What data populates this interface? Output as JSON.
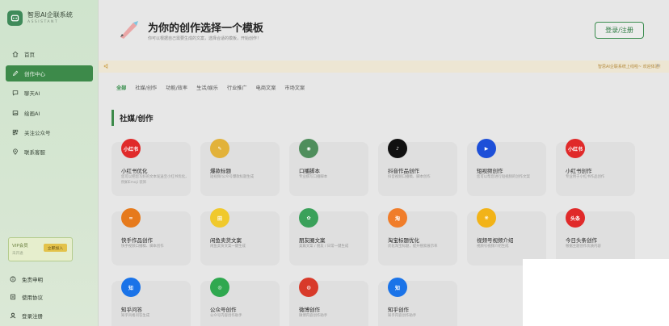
{
  "brand": {
    "title": "智思AI企联系统",
    "subtitle": "ASSISTANT"
  },
  "nav": [
    {
      "label": "首页",
      "icon": "home-icon"
    },
    {
      "label": "创作中心",
      "icon": "edit-icon",
      "active": true
    },
    {
      "label": "聊天AI",
      "icon": "chat-icon"
    },
    {
      "label": "绘画AI",
      "icon": "image-icon"
    },
    {
      "label": "关注公众号",
      "icon": "qrcode-icon"
    },
    {
      "label": "联系客服",
      "icon": "location-icon"
    }
  ],
  "vip": {
    "title": "VIP会员",
    "desc": "未开通",
    "button": "立即加入"
  },
  "bottom_nav": [
    {
      "label": "免责申明",
      "icon": "info-icon"
    },
    {
      "label": "使用协议",
      "icon": "doc-icon"
    },
    {
      "label": "登录注册",
      "icon": "user-icon"
    }
  ],
  "hero": {
    "title": "为你的创作选择一个模板",
    "subtitle": "你可以根据自己需要生成的文案，选择合适的模板，开始创作！"
  },
  "login_button": "登录/注册",
  "notice": {
    "text": "智思AI企联系统上线啦~ 欢迎体验！"
  },
  "tabs": [
    "全部",
    "社媒/创作",
    "功能/效率",
    "生活/娱乐",
    "行业推广",
    "电商文案",
    "市场文案"
  ],
  "section_title": "社媒/创作",
  "cards": [
    {
      "title": "小红书优化",
      "desc": "您可以把您写好的文本发送至小红书优化，例如Emoji 装饰",
      "icon_text": "小红书",
      "color": "#e02a2a"
    },
    {
      "title": "爆款标题",
      "desc": "短视频/公众号爆款标题生成",
      "icon_text": "✎",
      "color": "#e2b23a"
    },
    {
      "title": "口播脚本",
      "desc": "专业撰写口播脚本",
      "icon_text": "◉",
      "color": "#4f8e5c"
    },
    {
      "title": "抖音作品创作",
      "desc": "抖音视频口播稿、脚本创作",
      "icon_text": "♪",
      "color": "#111111"
    },
    {
      "title": "短视频创作",
      "desc": "您可以帮您进行短视频的创作文案",
      "icon_text": "▶",
      "color": "#1d4fd8"
    },
    {
      "title": "小红书创作",
      "desc": "专业用于小红书作品创作",
      "icon_text": "小红书",
      "color": "#e02a2a"
    },
    {
      "title": "快手作品创作",
      "desc": "快手视频口播稿、脚本创作",
      "icon_text": "∞",
      "color": "#e67a1c"
    },
    {
      "title": "闲鱼卖货文案",
      "desc": "闲鱼卖货文案一键生成",
      "icon_text": "田",
      "color": "#f0c92c"
    },
    {
      "title": "朋友圈文案",
      "desc": "美篇文案 / 朋友 / 日常一键生成",
      "icon_text": "✿",
      "color": "#3aa15a"
    },
    {
      "title": "淘宝标题优化",
      "desc": "优化淘宝标题，提升搜索展示率",
      "icon_text": "淘",
      "color": "#f07d2a"
    },
    {
      "title": "视频号视频介绍",
      "desc": "视频号视频介绍生成",
      "icon_text": "❋",
      "color": "#f2b318"
    },
    {
      "title": "今日头条创作",
      "desc": "根据主题创作优质内容",
      "icon_text": "头条",
      "color": "#e02a2a"
    },
    {
      "title": "知乎问答",
      "desc": "知乎风格问答生成",
      "icon_text": "知",
      "color": "#1a73e8"
    },
    {
      "title": "公众号创作",
      "desc": "公众号内容创作助手",
      "icon_text": "◎",
      "color": "#2fa84f"
    },
    {
      "title": "微博创作",
      "desc": "微博内容创作助手",
      "icon_text": "◍",
      "color": "#d83a2a"
    },
    {
      "title": "知乎创作",
      "desc": "知乎内容创作助手",
      "icon_text": "知",
      "color": "#1a73e8"
    }
  ]
}
